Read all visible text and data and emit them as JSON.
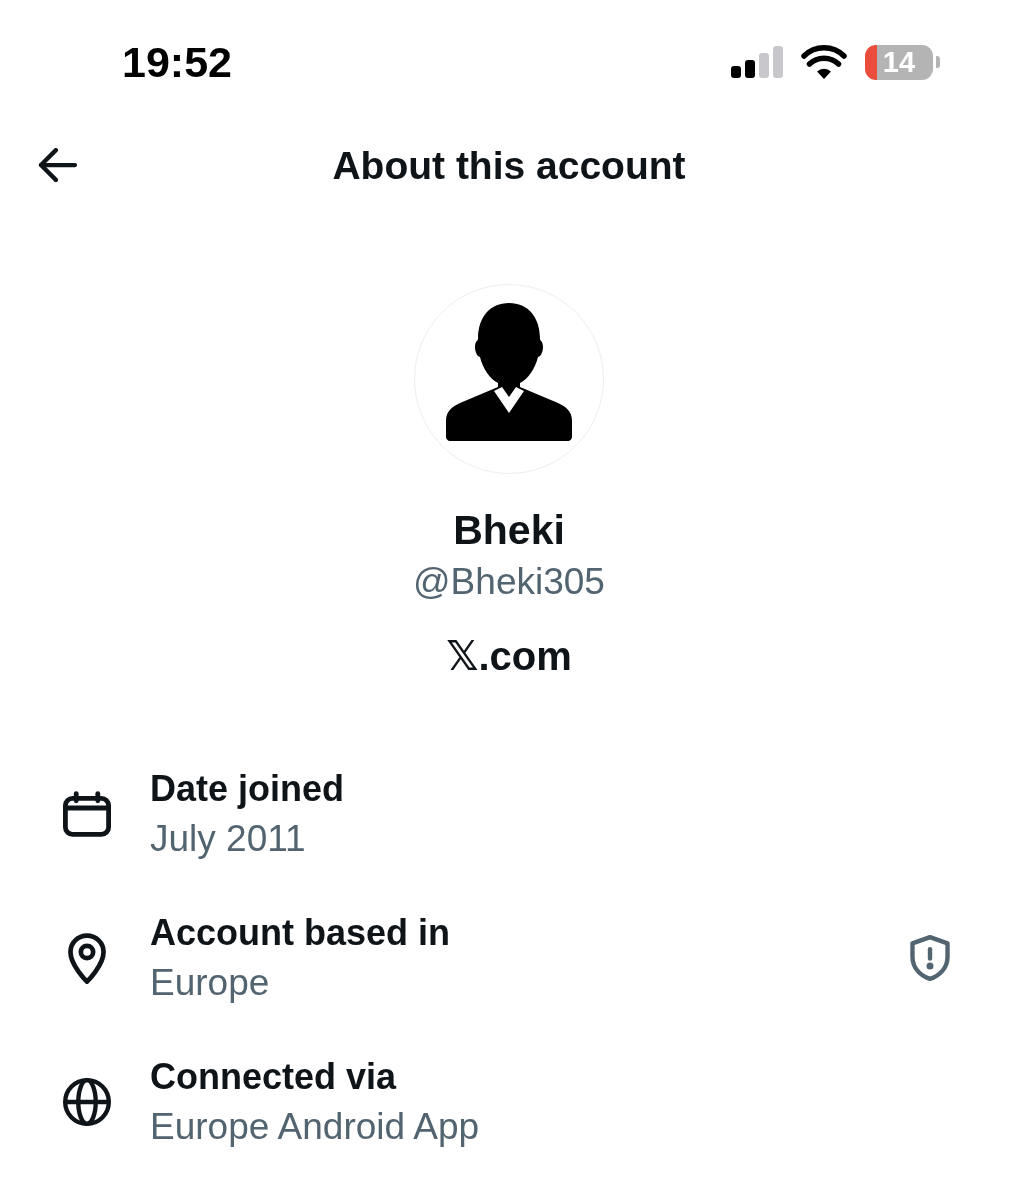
{
  "status_bar": {
    "time": "19:52",
    "battery": "14"
  },
  "header": {
    "title": "About this account"
  },
  "profile": {
    "name": "Bheki",
    "handle": "@Bheki305",
    "site": "𝕏.com"
  },
  "details": [
    {
      "kind": "calendar",
      "label": "Date joined",
      "value": "July 2011",
      "info": false
    },
    {
      "kind": "location",
      "label": "Account based in",
      "value": "Europe",
      "info": true
    },
    {
      "kind": "globe",
      "label": "Connected via",
      "value": "Europe Android App",
      "info": false
    }
  ]
}
